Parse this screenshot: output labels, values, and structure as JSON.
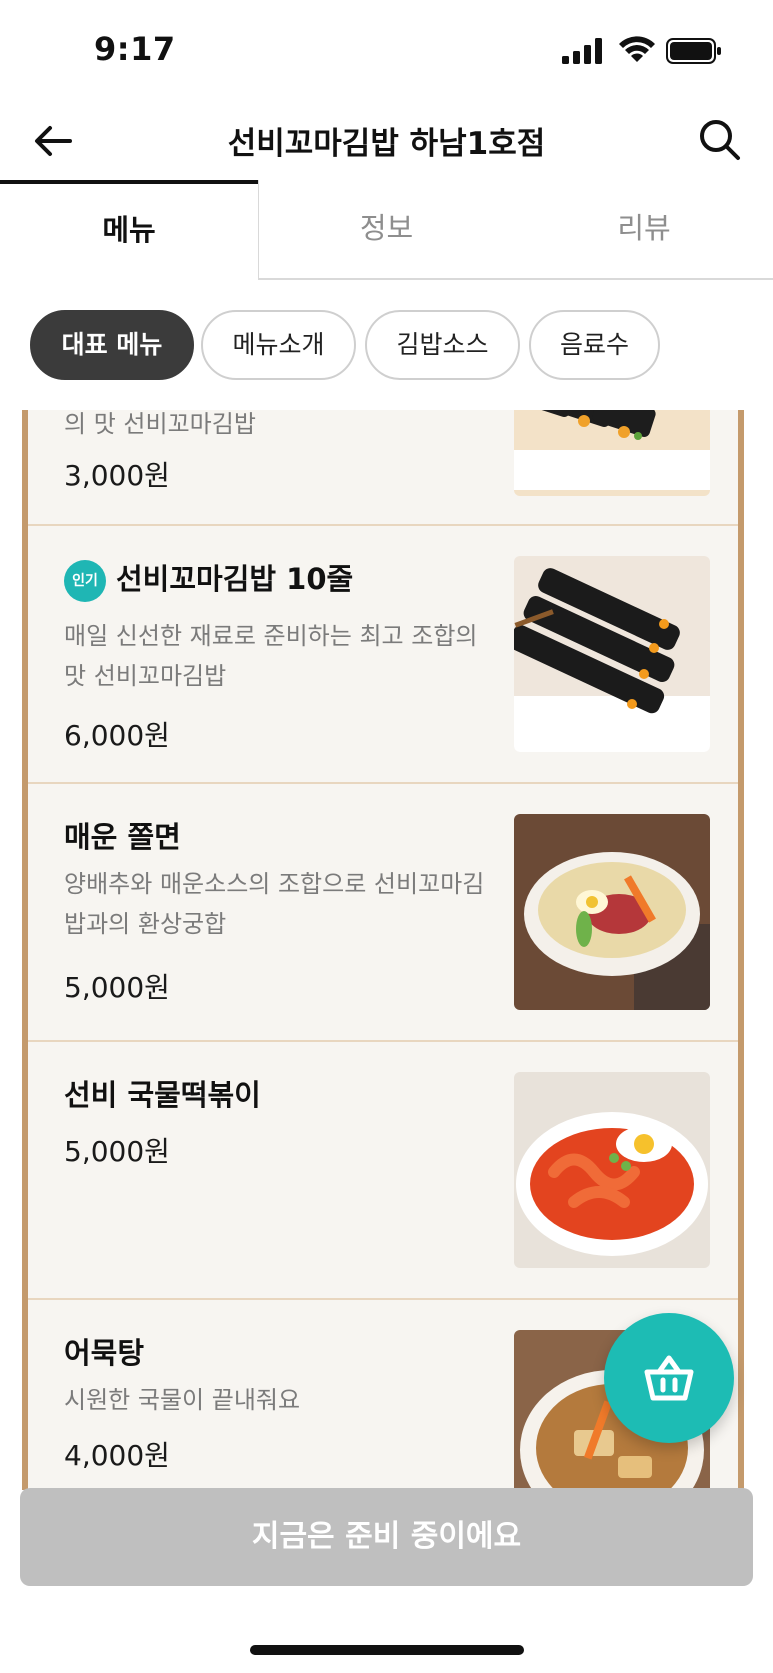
{
  "status": {
    "time": "9:17"
  },
  "header": {
    "title": "선비꼬마김밥 하남1호점"
  },
  "tabs": [
    {
      "label": "메뉴",
      "active": true
    },
    {
      "label": "정보",
      "active": false
    },
    {
      "label": "리뷰",
      "active": false
    }
  ],
  "chips": [
    {
      "label": "대표 메뉴",
      "active": true
    },
    {
      "label": "메뉴소개",
      "active": false
    },
    {
      "label": "김밥소스",
      "active": false
    },
    {
      "label": "음료수",
      "active": false
    }
  ],
  "menu": {
    "items": [
      {
        "desc_partial": "의 맛 선비꼬마김밥",
        "price": "3,000원"
      },
      {
        "badge": "인기",
        "name": "선비꼬마김밥 10줄",
        "desc": "매일 신선한 재료로 준비하는 최고 조합의 맛 선비꼬마김밥",
        "price": "6,000원"
      },
      {
        "name": "매운 쫄면",
        "desc": "양배추와 매운소스의 조합으로 선비꼬마김밥과의 환상궁합",
        "price": "5,000원"
      },
      {
        "name": "선비 국물떡볶이",
        "price": "5,000원"
      },
      {
        "name": "어묵탕",
        "desc": "시원한 국물이 끝내줘요",
        "price": "4,000원"
      }
    ]
  },
  "bottom": {
    "cta_label": "지금은 준비 중이에요"
  },
  "colors": {
    "accent": "#1dbcb4",
    "chip_active": "#3b3b3b",
    "border_wood": "#c49a6c",
    "cta_disabled": "#bfbfbf"
  },
  "icons": [
    "back-arrow-icon",
    "search-icon",
    "cart-basket-icon",
    "signal-icon",
    "wifi-icon",
    "battery-icon"
  ]
}
